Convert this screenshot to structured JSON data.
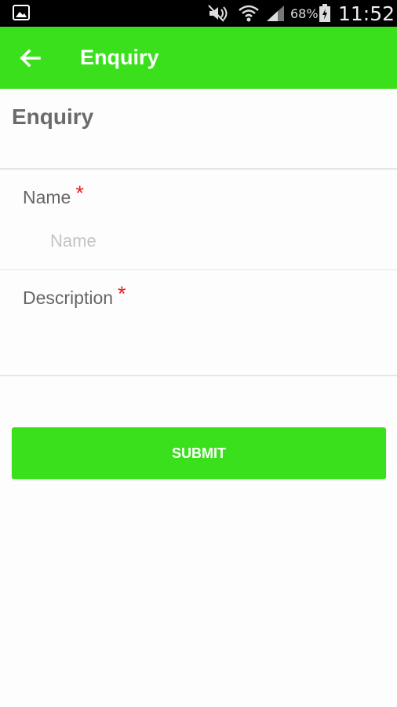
{
  "status_bar": {
    "battery_percent": "68%",
    "time": "11:52",
    "icons": [
      "gallery-icon",
      "mute-icon",
      "wifi-icon",
      "signal-icon",
      "battery-icon"
    ]
  },
  "app_bar": {
    "title": "Enquiry",
    "color": "#39e01b"
  },
  "page": {
    "heading": "Enquiry"
  },
  "form": {
    "name": {
      "label": "Name",
      "required_mark": "*",
      "placeholder": "Name",
      "value": ""
    },
    "description": {
      "label": "Description",
      "required_mark": "*",
      "placeholder": "",
      "value": ""
    },
    "submit_label": "SUBMIT"
  },
  "colors": {
    "accent": "#39e01b",
    "required": "#f01c1c"
  }
}
